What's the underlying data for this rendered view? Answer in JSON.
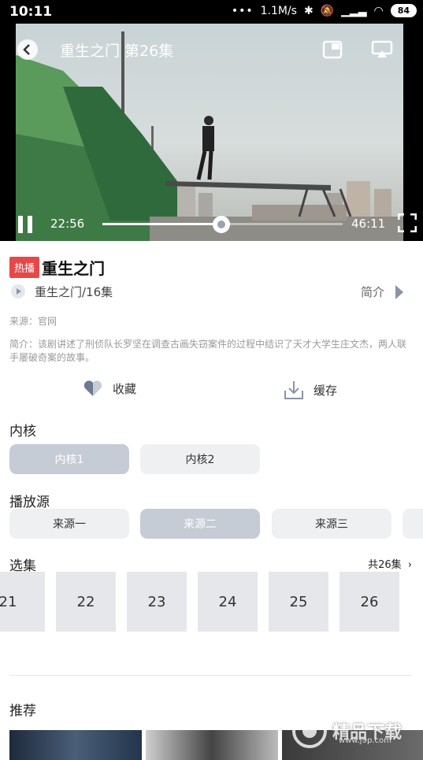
{
  "status_bar": {
    "time": "10:11",
    "network_speed": "1.1M/s",
    "battery": "84"
  },
  "player": {
    "title": "重生之门 第26集",
    "current_time": "22:56",
    "total_time": "46:11",
    "progress": 0.4966
  },
  "info": {
    "badge": "热播",
    "title": "重生之门",
    "subtitle": "重生之门/16集",
    "intro_label": "简介",
    "source": "来源：官网",
    "description": "简介：该剧讲述了刑侦队长罗坚在调查古画失窃案件的过程中结识了天才大学生庄文杰，两人联手屡破奇案的故事。"
  },
  "actions": {
    "favorite": "收藏",
    "download": "缓存"
  },
  "kernel": {
    "title": "内核",
    "options": [
      "内核1",
      "内核2"
    ],
    "selected": "内核1"
  },
  "play_source": {
    "title": "播放源",
    "options": [
      "来源一",
      "来源二",
      "来源三"
    ],
    "selected": "来源二"
  },
  "episodes": {
    "title": "选集",
    "total": "共26集",
    "items": [
      "21",
      "22",
      "23",
      "24",
      "25",
      "26"
    ]
  },
  "recommend": {
    "title": "推荐"
  },
  "watermark": {
    "text": "精品下载",
    "url": "www.j9p.com"
  }
}
